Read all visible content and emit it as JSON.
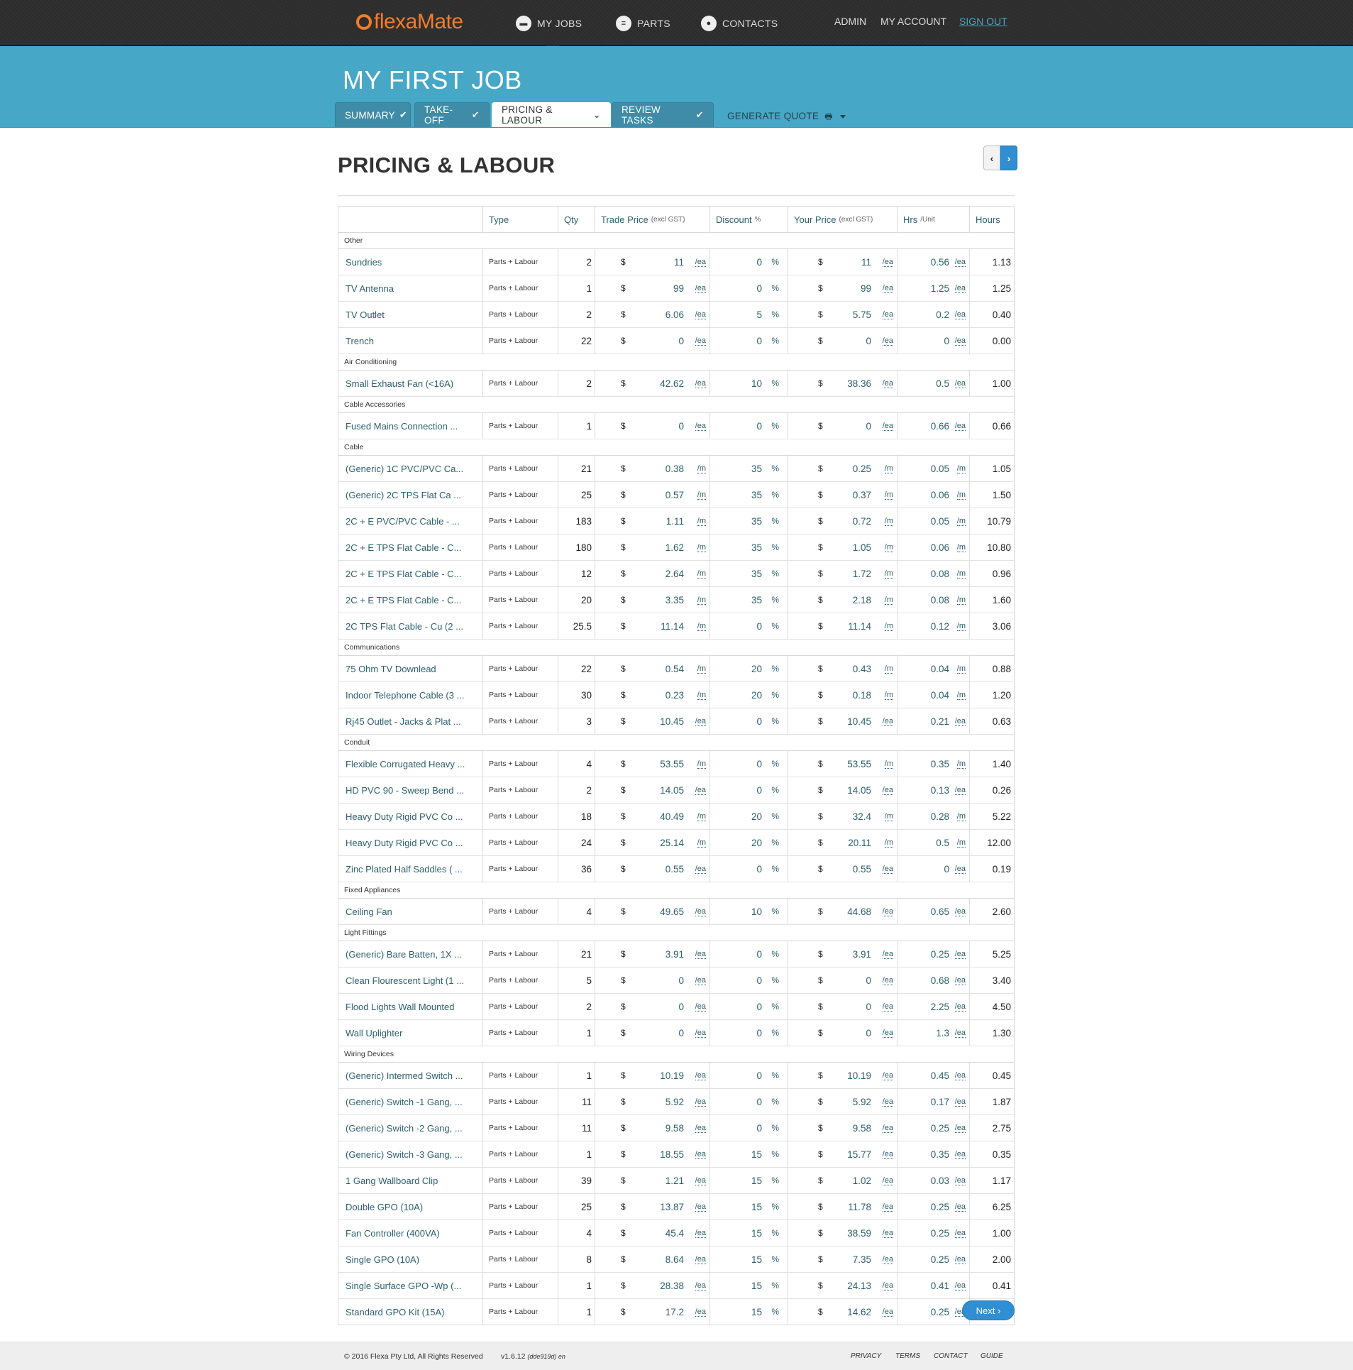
{
  "header": {
    "logo_text_a": "flexa",
    "logo_text_b": "Mate",
    "nav": [
      {
        "label": "MY JOBS",
        "icon": "briefcase-icon"
      },
      {
        "label": "PARTS",
        "icon": "document-icon"
      },
      {
        "label": "CONTACTS",
        "icon": "person-icon"
      }
    ],
    "admin": "ADMIN",
    "account": "MY ACCOUNT",
    "signout": "SIGN OUT"
  },
  "job": {
    "title": "MY FIRST JOB",
    "tabs": [
      "SUMMARY",
      "TAKE-OFF",
      "PRICING & LABOUR",
      "REVIEW TASKS"
    ],
    "active_tab": "PRICING & LABOUR",
    "generate_quote": "GENERATE QUOTE"
  },
  "page": {
    "title": "PRICING & LABOUR",
    "next": "Next"
  },
  "table": {
    "headers": {
      "type": "Type",
      "qty": "Qty",
      "trade": "Trade Price",
      "trade_small": "(excl GST)",
      "discount": "Discount",
      "discount_small": "%",
      "your": "Your Price",
      "your_small": "(excl GST)",
      "hrs": "Hrs",
      "hrs_small": "/Unit",
      "hours": "Hours"
    },
    "groups": [
      {
        "name": "Other",
        "rows": [
          [
            "Sundries",
            "Parts + Labour",
            "2",
            "11",
            "/ea",
            "0",
            "11",
            "/ea",
            "0.56",
            "/ea",
            "1.13"
          ],
          [
            "TV Antenna",
            "Parts + Labour",
            "1",
            "99",
            "/ea",
            "0",
            "99",
            "/ea",
            "1.25",
            "/ea",
            "1.25"
          ],
          [
            "TV Outlet",
            "Parts + Labour",
            "2",
            "6.06",
            "/ea",
            "5",
            "5.75",
            "/ea",
            "0.2",
            "/ea",
            "0.40"
          ],
          [
            "Trench",
            "Parts + Labour",
            "22",
            "0",
            "/ea",
            "0",
            "0",
            "/ea",
            "0",
            "/ea",
            "0.00"
          ]
        ]
      },
      {
        "name": "Air Conditioning",
        "rows": [
          [
            "Small Exhaust Fan (<16A)",
            "Parts + Labour",
            "2",
            "42.62",
            "/ea",
            "10",
            "38.36",
            "/ea",
            "0.5",
            "/ea",
            "1.00"
          ]
        ]
      },
      {
        "name": "Cable Accessories",
        "rows": [
          [
            "Fused Mains Connection ...",
            "Parts + Labour",
            "1",
            "0",
            "/ea",
            "0",
            "0",
            "/ea",
            "0.66",
            "/ea",
            "0.66"
          ]
        ]
      },
      {
        "name": "Cable",
        "rows": [
          [
            "(Generic) 1C PVC/PVC Ca...",
            "Parts + Labour",
            "21",
            "0.38",
            "/m",
            "35",
            "0.25",
            "/m",
            "0.05",
            "/m",
            "1.05"
          ],
          [
            "(Generic) 2C TPS Flat Ca ...",
            "Parts + Labour",
            "25",
            "0.57",
            "/m",
            "35",
            "0.37",
            "/m",
            "0.06",
            "/m",
            "1.50"
          ],
          [
            "2C + E PVC/PVC Cable - ...",
            "Parts + Labour",
            "183",
            "1.11",
            "/m",
            "35",
            "0.72",
            "/m",
            "0.05",
            "/m",
            "10.79"
          ],
          [
            "2C + E TPS Flat Cable - C...",
            "Parts + Labour",
            "180",
            "1.62",
            "/m",
            "35",
            "1.05",
            "/m",
            "0.06",
            "/m",
            "10.80"
          ],
          [
            "2C + E TPS Flat Cable - C...",
            "Parts + Labour",
            "12",
            "2.64",
            "/m",
            "35",
            "1.72",
            "/m",
            "0.08",
            "/m",
            "0.96"
          ],
          [
            "2C + E TPS Flat Cable - C...",
            "Parts + Labour",
            "20",
            "3.35",
            "/m",
            "35",
            "2.18",
            "/m",
            "0.08",
            "/m",
            "1.60"
          ],
          [
            "2C TPS Flat Cable - Cu (2 ...",
            "Parts + Labour",
            "25.5",
            "11.14",
            "/m",
            "0",
            "11.14",
            "/m",
            "0.12",
            "/m",
            "3.06"
          ]
        ]
      },
      {
        "name": "Communications",
        "rows": [
          [
            "75 Ohm TV Downlead",
            "Parts + Labour",
            "22",
            "0.54",
            "/m",
            "20",
            "0.43",
            "/m",
            "0.04",
            "/m",
            "0.88"
          ],
          [
            "Indoor Telephone Cable (3 ...",
            "Parts + Labour",
            "30",
            "0.23",
            "/m",
            "20",
            "0.18",
            "/m",
            "0.04",
            "/m",
            "1.20"
          ],
          [
            "Rj45 Outlet - Jacks & Plat ...",
            "Parts + Labour",
            "3",
            "10.45",
            "/ea",
            "0",
            "10.45",
            "/ea",
            "0.21",
            "/ea",
            "0.63"
          ]
        ]
      },
      {
        "name": "Conduit",
        "rows": [
          [
            "Flexible Corrugated Heavy ...",
            "Parts + Labour",
            "4",
            "53.55",
            "/m",
            "0",
            "53.55",
            "/m",
            "0.35",
            "/m",
            "1.40"
          ],
          [
            "HD PVC 90 - Sweep Bend ...",
            "Parts + Labour",
            "2",
            "14.05",
            "/ea",
            "0",
            "14.05",
            "/ea",
            "0.13",
            "/ea",
            "0.26"
          ],
          [
            "Heavy Duty Rigid PVC Co ...",
            "Parts + Labour",
            "18",
            "40.49",
            "/m",
            "20",
            "32.4",
            "/m",
            "0.28",
            "/m",
            "5.22"
          ],
          [
            "Heavy Duty Rigid PVC Co ...",
            "Parts + Labour",
            "24",
            "25.14",
            "/m",
            "20",
            "20.11",
            "/m",
            "0.5",
            "/m",
            "12.00"
          ],
          [
            "Zinc Plated Half Saddles ( ...",
            "Parts + Labour",
            "36",
            "0.55",
            "/ea",
            "0",
            "0.55",
            "/ea",
            "0",
            "/ea",
            "0.19"
          ]
        ]
      },
      {
        "name": "Fixed Appliances",
        "rows": [
          [
            "Ceiling Fan",
            "Parts + Labour",
            "4",
            "49.65",
            "/ea",
            "10",
            "44.68",
            "/ea",
            "0.65",
            "/ea",
            "2.60"
          ]
        ]
      },
      {
        "name": "Light Fittings",
        "rows": [
          [
            "(Generic) Bare Batten, 1X ...",
            "Parts + Labour",
            "21",
            "3.91",
            "/ea",
            "0",
            "3.91",
            "/ea",
            "0.25",
            "/ea",
            "5.25"
          ],
          [
            "Clean Flourescent Light (1 ...",
            "Parts + Labour",
            "5",
            "0",
            "/ea",
            "0",
            "0",
            "/ea",
            "0.68",
            "/ea",
            "3.40"
          ],
          [
            "Flood Lights Wall Mounted",
            "Parts + Labour",
            "2",
            "0",
            "/ea",
            "0",
            "0",
            "/ea",
            "2.25",
            "/ea",
            "4.50"
          ],
          [
            "Wall Uplighter",
            "Parts + Labour",
            "1",
            "0",
            "/ea",
            "0",
            "0",
            "/ea",
            "1.3",
            "/ea",
            "1.30"
          ]
        ]
      },
      {
        "name": "Wiring Devices",
        "rows": [
          [
            "(Generic) Intermed Switch ...",
            "Parts + Labour",
            "1",
            "10.19",
            "/ea",
            "0",
            "10.19",
            "/ea",
            "0.45",
            "/ea",
            "0.45"
          ],
          [
            "(Generic) Switch -1 Gang, ...",
            "Parts + Labour",
            "11",
            "5.92",
            "/ea",
            "0",
            "5.92",
            "/ea",
            "0.17",
            "/ea",
            "1.87"
          ],
          [
            "(Generic) Switch -2 Gang, ...",
            "Parts + Labour",
            "11",
            "9.58",
            "/ea",
            "0",
            "9.58",
            "/ea",
            "0.25",
            "/ea",
            "2.75"
          ],
          [
            "(Generic) Switch -3 Gang, ...",
            "Parts + Labour",
            "1",
            "18.55",
            "/ea",
            "15",
            "15.77",
            "/ea",
            "0.35",
            "/ea",
            "0.35"
          ],
          [
            "1 Gang Wallboard Clip",
            "Parts + Labour",
            "39",
            "1.21",
            "/ea",
            "15",
            "1.02",
            "/ea",
            "0.03",
            "/ea",
            "1.17"
          ],
          [
            "Double GPO (10A)",
            "Parts + Labour",
            "25",
            "13.87",
            "/ea",
            "15",
            "11.78",
            "/ea",
            "0.25",
            "/ea",
            "6.25"
          ],
          [
            "Fan Controller (400VA)",
            "Parts + Labour",
            "4",
            "45.4",
            "/ea",
            "15",
            "38.59",
            "/ea",
            "0.25",
            "/ea",
            "1.00"
          ],
          [
            "Single GPO (10A)",
            "Parts + Labour",
            "8",
            "8.64",
            "/ea",
            "15",
            "7.35",
            "/ea",
            "0.25",
            "/ea",
            "2.00"
          ],
          [
            "Single Surface GPO -Wp (...",
            "Parts + Labour",
            "1",
            "28.38",
            "/ea",
            "15",
            "24.13",
            "/ea",
            "0.41",
            "/ea",
            "0.41"
          ],
          [
            "Standard GPO Kit (15A)",
            "Parts + Labour",
            "1",
            "17.2",
            "/ea",
            "15",
            "14.62",
            "/ea",
            "0.25",
            "/ea",
            "0.25"
          ]
        ]
      }
    ],
    "currency": "$",
    "pct": "%"
  },
  "footer": {
    "copyright": "© 2016 Flexa Pty Ltd, All Rights Reserved",
    "version": "v1.6.12",
    "build": "(dde919d) en",
    "links": [
      "PRIVACY",
      "TERMS",
      "CONTACT",
      "GUIDE"
    ]
  },
  "colors": {
    "topbar": "#2c2c2c",
    "band": "#46a7c6",
    "accent": "#2f8fd2",
    "logo": "#f07d2a"
  }
}
